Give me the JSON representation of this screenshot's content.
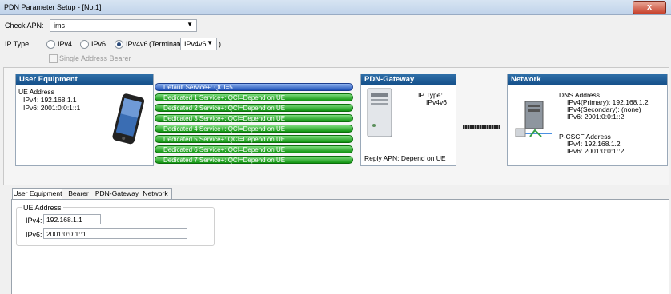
{
  "window": {
    "title": "PDN Parameter Setup - [No.1]",
    "close_label": "x"
  },
  "apn": {
    "label": "Check APN:",
    "value": "ims"
  },
  "ip_type": {
    "label": "IP Type:",
    "options": [
      "IPv4",
      "IPv6",
      "IPv4v6"
    ],
    "selected": "IPv4v6",
    "terminate_label": "(Terminate:",
    "terminate_value": "IPv4v6",
    "terminate_close": ")"
  },
  "single_bearer": {
    "label": "Single Address Bearer",
    "checked": false
  },
  "user_equipment": {
    "title": "User Equipment",
    "address_title": "UE Address",
    "ipv4": "IPv4: 192.168.1.1",
    "ipv6": "IPv6: 2001:0:0:1::1"
  },
  "services": [
    "Default Service+: QCI=5",
    "Dedicated 1 Service+: QCI=Depend on UE",
    "Dedicated 2 Service+: QCI=Depend on UE",
    "Dedicated 3 Service+: QCI=Depend on UE",
    "Dedicated 4 Service+: QCI=Depend on UE",
    "Dedicated 5 Service+: QCI=Depend on UE",
    "Dedicated 6 Service+: QCI=Depend on UE",
    "Dedicated 7 Service+: QCI=Depend on UE"
  ],
  "pdn_gateway": {
    "title": "PDN-Gateway",
    "ip_type_label": "IP Type:",
    "ip_type_value": "IPv4v6",
    "reply_apn": "Reply APN: Depend on UE"
  },
  "network": {
    "title": "Network",
    "dns_title": "DNS Address",
    "dns_primary": "IPv4(Primary): 192.168.1.2",
    "dns_secondary": "IPv4(Secondary): (none)",
    "dns_ipv6": "IPv6: 2001:0:0:1::2",
    "pcscf_title": "P-CSCF Address",
    "pcscf_ipv4": "IPv4: 192.168.1.2",
    "pcscf_ipv6": "IPv6: 2001:0:0:1::2"
  },
  "tabs": [
    "User Equipment",
    "Bearer",
    "PDN-Gateway",
    "Network"
  ],
  "active_tab": "User Equipment",
  "ue_form": {
    "group_title": "UE Address",
    "ipv4_label": "IPv4:",
    "ipv4_value": "192.168.1.1",
    "ipv6_label": "IPv6:",
    "ipv6_value": "2001:0:0:1::1"
  }
}
